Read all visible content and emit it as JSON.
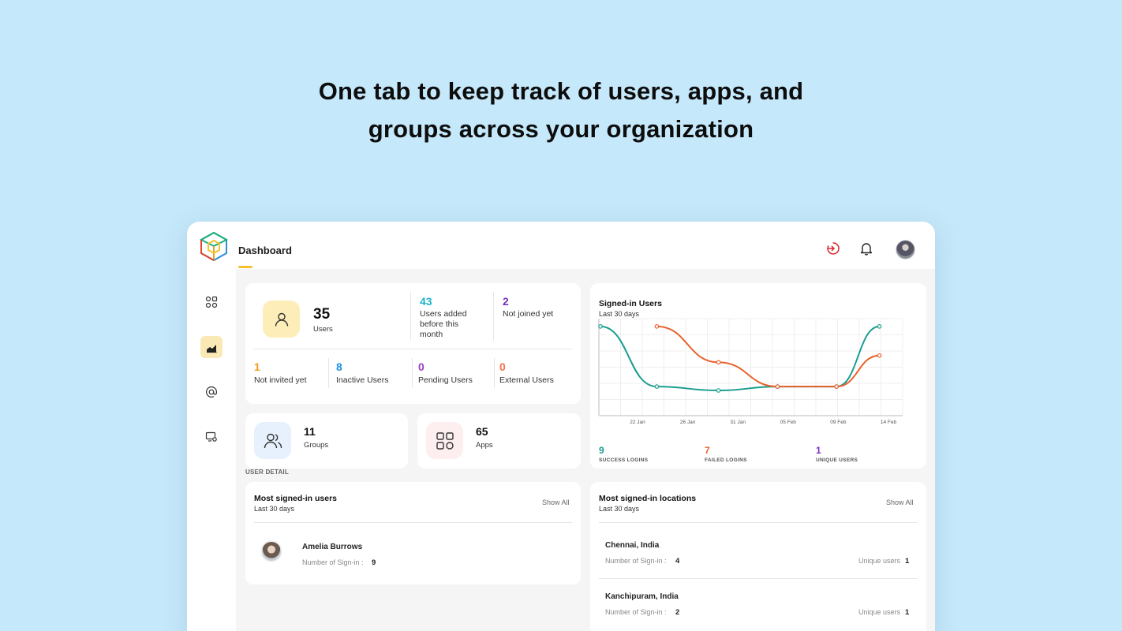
{
  "headline": {
    "line1": "One tab to keep track of users, apps, and",
    "line2": "groups across your organization"
  },
  "topbar": {
    "tab_label": "Dashboard",
    "icons": [
      "logo-cube-icon",
      "sign-in-activity-icon",
      "bell-icon",
      "user-avatar"
    ]
  },
  "sidebar": {
    "items": [
      {
        "icon": "apps-grid-icon",
        "active": false
      },
      {
        "icon": "chart-icon",
        "active": true
      },
      {
        "icon": "at-sign-icon",
        "active": false
      },
      {
        "icon": "device-settings-icon",
        "active": false
      }
    ]
  },
  "users_summary": {
    "total": "35",
    "total_label": "Users",
    "added_value": "43",
    "added_label_1": "Users added",
    "added_label_2": "before this",
    "added_label_3": "month",
    "not_joined_value": "2",
    "not_joined_label": "Not joined yet",
    "not_invited_value": "1",
    "not_invited_label": "Not invited yet",
    "inactive_value": "8",
    "inactive_label": "Inactive Users",
    "pending_value": "0",
    "pending_label": "Pending Users",
    "external_value": "0",
    "external_label": "External Users"
  },
  "groups": {
    "value": "11",
    "label": "Groups"
  },
  "apps": {
    "value": "65",
    "label": "Apps"
  },
  "signin_chart": {
    "title": "Signed-in Users",
    "subtitle": "Last 30 days",
    "success_value": "9",
    "success_label": "SUCCESS LOGINS",
    "failed_value": "7",
    "failed_label": "FAILED LOGINS",
    "unique_value": "1",
    "unique_label": "UNIQUE USERS"
  },
  "chart_data": {
    "type": "line",
    "x_ticks": [
      "22 Jan",
      "26 Jan",
      "31 Jan",
      "05 Feb",
      "09 Feb",
      "14 Feb"
    ],
    "grid": true,
    "series": [
      {
        "color": "#1a9e8f",
        "points": [
          [
            0,
            0.92
          ],
          [
            1.05,
            0.3
          ],
          [
            2.2,
            0.26
          ],
          [
            3.3,
            0.3
          ],
          [
            4.4,
            0.3
          ],
          [
            5.2,
            0.92
          ]
        ]
      },
      {
        "color": "#e8622c",
        "points": [
          [
            1.05,
            0.92
          ],
          [
            2.2,
            0.55
          ],
          [
            3.3,
            0.3
          ],
          [
            4.4,
            0.3
          ],
          [
            5.2,
            0.62
          ]
        ]
      }
    ],
    "colors": {
      "success": "#1a9e8f",
      "failed": "#e8622c",
      "unique": "#7b2fbf"
    }
  },
  "user_detail": {
    "section_label": "USER DETAIL",
    "most_signed_users": {
      "title": "Most signed-in users",
      "subtitle": "Last 30 days",
      "show_all": "Show All",
      "rows": [
        {
          "name": "Amelia Burrows",
          "meta_label": "Number of Sign-in :",
          "meta_value": "9"
        }
      ]
    },
    "locations": {
      "title": "Most signed-in locations",
      "subtitle": "Last 30 days",
      "show_all": "Show All",
      "rows": [
        {
          "name": "Chennai, India",
          "meta_label": "Number of Sign-in :",
          "meta_value": "4",
          "unique_label": "Unique users",
          "unique_value": "1"
        },
        {
          "name": "Kanchipuram, India",
          "meta_label": "Number of Sign-in :",
          "meta_value": "2",
          "unique_label": "Unique users",
          "unique_value": "1"
        }
      ]
    }
  },
  "colors": {
    "background": "#c5e8fa",
    "accent_yellow": "#f5c12e",
    "cyan": "#1bb4c9",
    "blue": "#1f8fe0",
    "purple": "#7b2fbf",
    "orange": "#f39a1c",
    "coral": "#f0704a"
  }
}
